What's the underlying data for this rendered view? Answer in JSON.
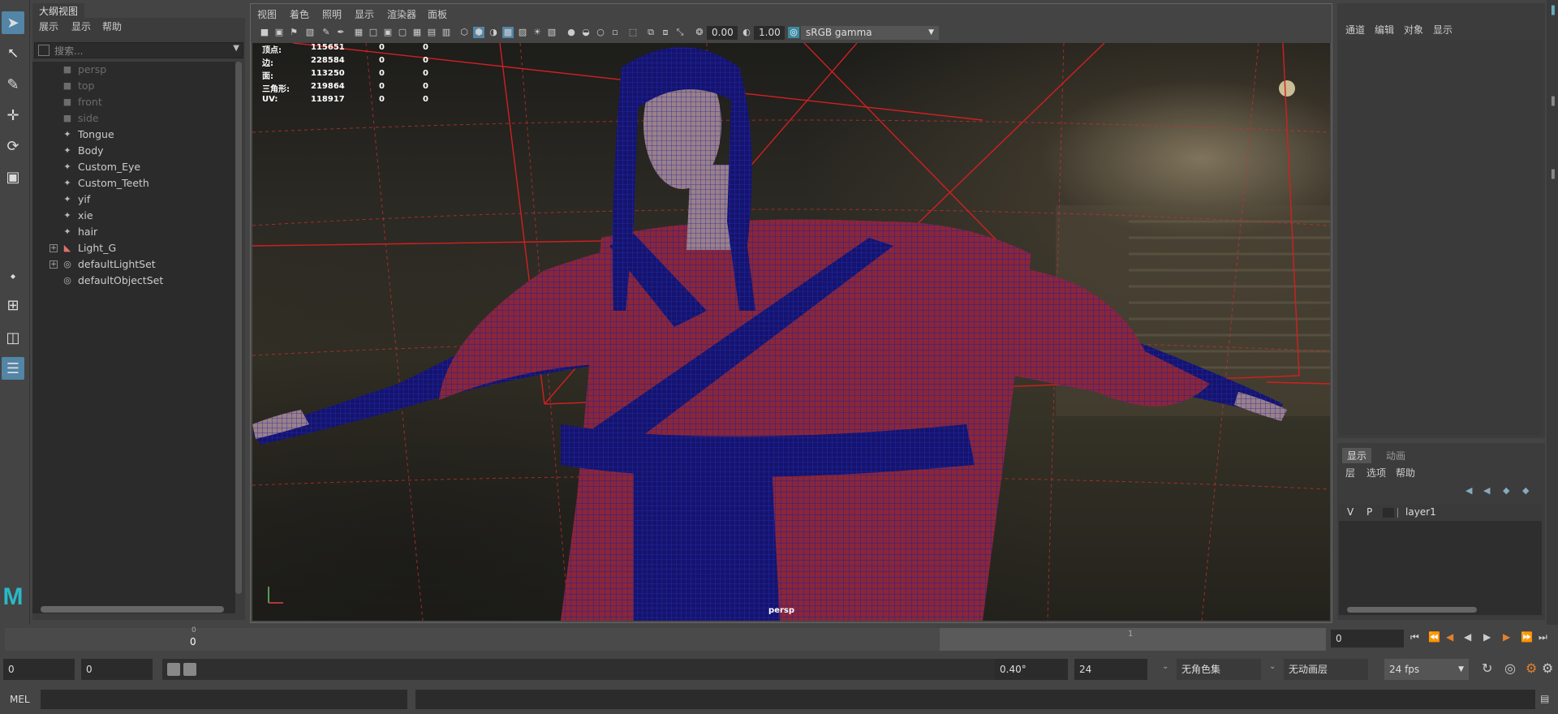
{
  "outliner": {
    "tab_title": "大纲视图",
    "menus": [
      "展示",
      "显示",
      "帮助"
    ],
    "search_placeholder": "搜索...",
    "items": [
      {
        "label": "persp",
        "icon": "camera-icon",
        "dim": true
      },
      {
        "label": "top",
        "icon": "camera-icon",
        "dim": true
      },
      {
        "label": "front",
        "icon": "camera-icon",
        "dim": true
      },
      {
        "label": "side",
        "icon": "camera-icon",
        "dim": true
      },
      {
        "label": "Tongue",
        "icon": "transform-icon",
        "dim": false
      },
      {
        "label": "Body",
        "icon": "transform-icon",
        "dim": false
      },
      {
        "label": "Custom_Eye",
        "icon": "transform-icon",
        "dim": false
      },
      {
        "label": "Custom_Teeth",
        "icon": "transform-icon",
        "dim": false
      },
      {
        "label": "yif",
        "icon": "transform-icon",
        "dim": false
      },
      {
        "label": "xie",
        "icon": "transform-icon",
        "dim": false
      },
      {
        "label": "hair",
        "icon": "transform-icon",
        "dim": false
      },
      {
        "label": "Light_G",
        "icon": "light-icon",
        "dim": false
      },
      {
        "label": "defaultLightSet",
        "icon": "set-icon",
        "dim": false
      },
      {
        "label": "defaultObjectSet",
        "icon": "set-icon",
        "dim": false
      }
    ]
  },
  "viewport": {
    "menus": [
      "视图",
      "着色",
      "照明",
      "显示",
      "渲染器",
      "面板"
    ],
    "exposure": "0.00",
    "gamma": "1.00",
    "color_space": "sRGB gamma",
    "camera_label": "persp",
    "hud": [
      {
        "label": "顶点:",
        "v1": "115651",
        "v2": "0",
        "v3": "0"
      },
      {
        "label": "边:",
        "v1": "228584",
        "v2": "0",
        "v3": "0"
      },
      {
        "label": "面:",
        "v1": "113250",
        "v2": "0",
        "v3": "0"
      },
      {
        "label": "三角形:",
        "v1": "219864",
        "v2": "0",
        "v3": "0"
      },
      {
        "label": "UV:",
        "v1": "118917",
        "v2": "0",
        "v3": "0"
      }
    ]
  },
  "channelbox": {
    "menus": [
      "通道",
      "编辑",
      "对象",
      "显示"
    ]
  },
  "layers": {
    "tabs": [
      "显示",
      "动画"
    ],
    "menus": [
      "层",
      "选项",
      "帮助"
    ],
    "layer_v": "V",
    "layer_p": "P",
    "layer_name": "layer1"
  },
  "timeline": {
    "start_tick": "0",
    "end_tick": "1",
    "current_label": "0",
    "current_frame": "0"
  },
  "range": {
    "start": "0",
    "anim_start": "0",
    "angle": "0.40°",
    "end": "24",
    "character_set": "无角色集",
    "anim_layer": "无动画层",
    "fps": "24 fps"
  },
  "cmdline": {
    "label": "MEL"
  },
  "colors": {
    "accent": "#5285a6",
    "grid": "#d03030",
    "wire": "#1a1aa0",
    "robe": "#8a2638"
  }
}
